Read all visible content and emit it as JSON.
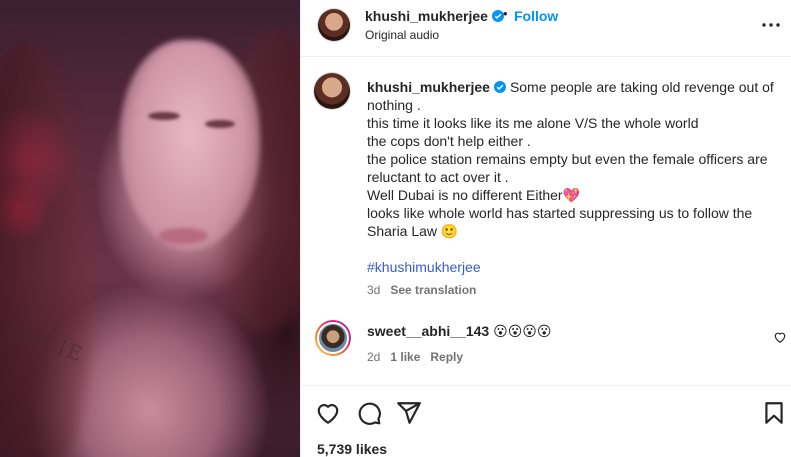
{
  "post": {
    "username": "khushi_mukherjee",
    "follow_label": "Follow",
    "dot": "•",
    "audio": "Original audio"
  },
  "caption": {
    "username": "khushi_mukherjee",
    "lines": [
      "Some people are taking old revenge out of",
      "nothing .",
      "this time it looks like its me alone V/S the whole world",
      "the cops don't help either .",
      "the police station remains empty but even the female officers are",
      "reluctant to act over it .",
      "Well Dubai is no different Either💖",
      "looks like whole world has started suppressing us to follow the",
      "Sharia Law 🙂"
    ],
    "hashtag": "#khushimukherjee",
    "time": "3d",
    "see_translation": "See translation"
  },
  "comment": {
    "username": "sweet__abhi__143",
    "text": "😮😮😮😮",
    "time": "2d",
    "likes": "1 like",
    "reply": "Reply"
  },
  "likes_count": "5,739 likes",
  "media": {
    "tattoo_text": "SOCIE"
  },
  "colors": {
    "accent": "#0095f6",
    "verified": "#0095f6",
    "hashtag": "#3b5cc9",
    "muted": "#737373"
  },
  "icons": [
    "verified-icon",
    "more-options-icon",
    "heart-icon",
    "comment-icon",
    "share-icon",
    "bookmark-icon"
  ]
}
